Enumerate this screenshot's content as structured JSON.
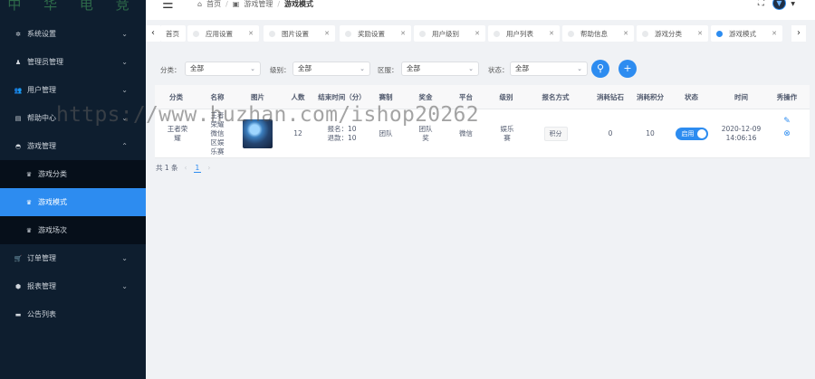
{
  "app": {
    "logo_text": "中 华 电 竞"
  },
  "sidebar": {
    "items": [
      {
        "label": "系统设置",
        "icon": "gear-icon"
      },
      {
        "label": "管理员管理",
        "icon": "user-tie-icon"
      },
      {
        "label": "用户管理",
        "icon": "users-icon"
      },
      {
        "label": "帮助中心",
        "icon": "book-icon"
      },
      {
        "label": "游戏管理",
        "icon": "gamepad-icon"
      },
      {
        "label": "订单管理",
        "icon": "cart-icon"
      },
      {
        "label": "报表管理",
        "icon": "cube-icon"
      },
      {
        "label": "公告列表",
        "icon": "notice-icon"
      }
    ],
    "submenu": [
      {
        "label": "游戏分类",
        "icon": "trophy-icon"
      },
      {
        "label": "游戏模式",
        "icon": "trophy-icon"
      },
      {
        "label": "游戏场次",
        "icon": "trophy-icon"
      }
    ]
  },
  "header": {
    "breadcrumb": {
      "home": "首页",
      "parent": "游戏管理",
      "current": "游戏模式"
    }
  },
  "tabs": [
    {
      "label": "首页"
    },
    {
      "label": "应用设置"
    },
    {
      "label": "图片设置"
    },
    {
      "label": "奖励设置"
    },
    {
      "label": "用户级别"
    },
    {
      "label": "用户列表"
    },
    {
      "label": "帮助信息"
    },
    {
      "label": "游戏分类"
    },
    {
      "label": "游戏模式"
    }
  ],
  "filters": {
    "category_label": "分类：",
    "category_value": "全部",
    "level_label": "级别：",
    "level_value": "全部",
    "region_label": "区服：",
    "region_value": "全部",
    "status_label": "状态：",
    "status_value": "全部"
  },
  "table": {
    "headers": [
      "分类",
      "名称",
      "图片",
      "人数",
      "结束时间（分）",
      "赛制",
      "奖金",
      "平台",
      "级别",
      "报名方式",
      "消耗钻石",
      "消耗积分",
      "状态",
      "时间",
      "秀操作"
    ],
    "rows": [
      {
        "category": "王者荣耀",
        "name": "王者荣耀微信区娱乐赛",
        "people": "12",
        "end_time_signup": "报名：10",
        "end_time_exit": "退款：10",
        "format": "团队",
        "prize": "团队奖",
        "platform": "微信",
        "level": "娱乐赛",
        "signup": "积分",
        "diamond": "0",
        "points": "10",
        "status": "启用",
        "date": "2020-12-09",
        "time": "14:06:16"
      }
    ]
  },
  "pagination": {
    "total": "共 1 条",
    "page": "1"
  },
  "watermark": "https://www.huzhan.com/ishop20262"
}
